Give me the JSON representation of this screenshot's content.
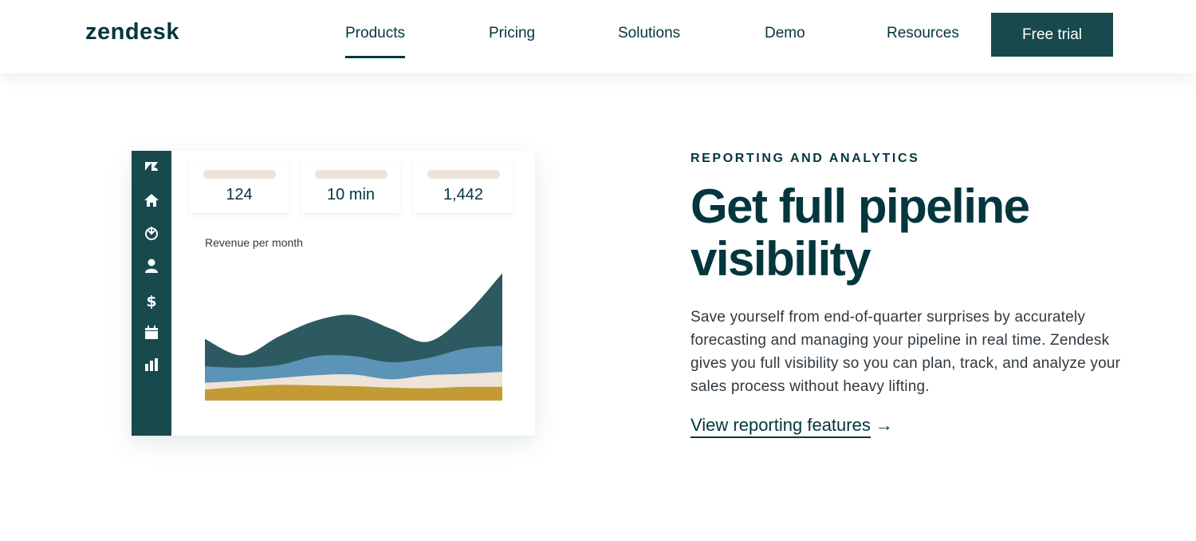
{
  "header": {
    "logo": "zendesk",
    "nav": [
      {
        "label": "Products",
        "active": true
      },
      {
        "label": "Pricing",
        "active": false
      },
      {
        "label": "Solutions",
        "active": false
      },
      {
        "label": "Demo",
        "active": false
      },
      {
        "label": "Resources",
        "active": false
      }
    ],
    "cta_label": "Free trial"
  },
  "dashboard": {
    "sidebar_icons": [
      "zendesk-logo-icon",
      "home-icon",
      "pipeline-icon",
      "user-icon",
      "dollar-icon",
      "calendar-icon",
      "bar-chart-icon"
    ],
    "stats": [
      {
        "value": "124"
      },
      {
        "value": "10 min"
      },
      {
        "value": "1,442"
      }
    ],
    "chart_title": "Revenue per month"
  },
  "chart_data": {
    "type": "area",
    "title": "Revenue per month",
    "xlabel": "",
    "ylabel": "",
    "grid": false,
    "legend": "none",
    "stacked": true,
    "x": [
      0,
      1,
      2,
      3,
      4,
      5,
      6,
      7,
      8
    ],
    "series": [
      {
        "color": "#c49a34",
        "values": [
          16,
          20,
          23,
          22,
          21,
          19,
          18,
          20,
          20
        ]
      },
      {
        "color": "#ede3d8",
        "values": [
          10,
          9,
          10,
          15,
          17,
          12,
          19,
          19,
          22
        ]
      },
      {
        "color": "#5b94b7",
        "values": [
          24,
          19,
          19,
          28,
          27,
          25,
          25,
          37,
          38
        ]
      },
      {
        "color": "#2d5a60",
        "values": [
          40,
          18,
          42,
          52,
          60,
          49,
          24,
          49,
          106
        ]
      }
    ],
    "ylim": [
      0,
      190
    ]
  },
  "content": {
    "eyebrow": "REPORTING AND ANALYTICS",
    "headline": "Get full pipeline visibility",
    "body": "Save yourself from end-of-quarter surprises by accurately forecasting and managing your pipeline in real time. Zendesk gives you full visibility so you can plan, track, and analyze your sales process without heavy lifting.",
    "link_label": "View reporting features",
    "link_arrow": "→"
  }
}
